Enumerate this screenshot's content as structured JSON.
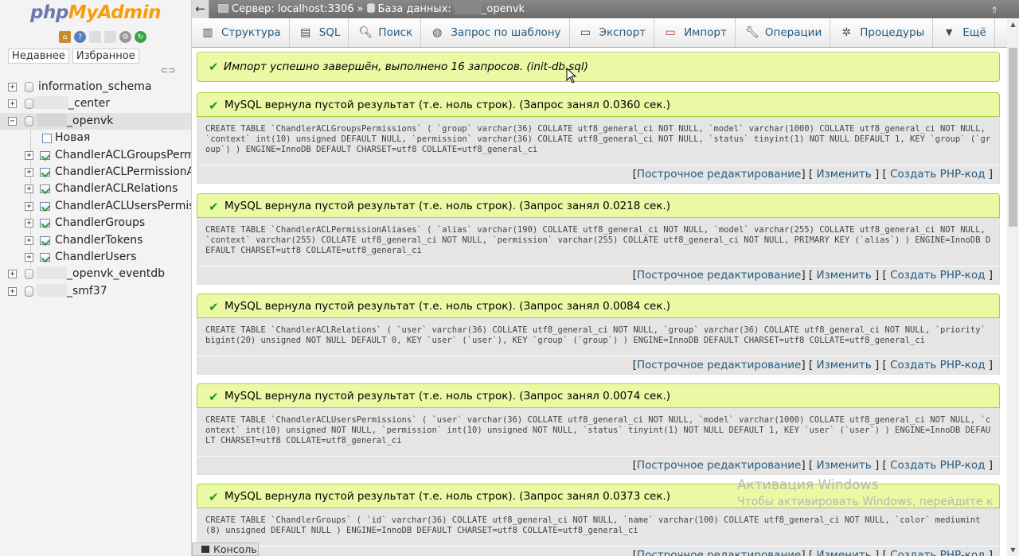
{
  "logo": {
    "part1": "php",
    "part2": "MyAdmin"
  },
  "nav": {
    "tabs": [
      "Недавнее",
      "Избранное"
    ],
    "tree": [
      {
        "label": "information_schema"
      },
      {
        "label": "_center",
        "redacted": true
      },
      {
        "label": "_openvk",
        "redacted": true,
        "selected": true
      },
      {
        "label": "Новая",
        "kind": "new"
      },
      {
        "label": "ChandlerACLGroupsPermissi",
        "kind": "table"
      },
      {
        "label": "ChandlerACLPermissionAlias",
        "kind": "table"
      },
      {
        "label": "ChandlerACLRelations",
        "kind": "table"
      },
      {
        "label": "ChandlerACLUsersPermissio",
        "kind": "table"
      },
      {
        "label": "ChandlerGroups",
        "kind": "table"
      },
      {
        "label": "ChandlerTokens",
        "kind": "table"
      },
      {
        "label": "ChandlerUsers",
        "kind": "table"
      },
      {
        "label": "_openvk_eventdb",
        "redacted": true
      },
      {
        "label": "_smf37",
        "redacted": true
      }
    ]
  },
  "topbar": {
    "server_label": "Сервер: localhost:3306",
    "separator": "»",
    "db_label": "База данных:",
    "db_name": "_openvk"
  },
  "tabs": [
    {
      "label": "Структура",
      "icon": "structure-icon"
    },
    {
      "label": "SQL",
      "icon": "sql-icon"
    },
    {
      "label": "Поиск",
      "icon": "search-icon"
    },
    {
      "label": "Запрос по шаблону",
      "icon": "query-icon"
    },
    {
      "label": "Экспорт",
      "icon": "export-icon"
    },
    {
      "label": "Импорт",
      "icon": "import-icon"
    },
    {
      "label": "Операции",
      "icon": "wrench-icon"
    },
    {
      "label": "Процедуры",
      "icon": "routines-icon"
    },
    {
      "label": "Ещё",
      "icon": "chevron-down-icon"
    }
  ],
  "import_notice": "Импорт успешно завершён, выполнено 16 запросов. (init-db.sql)",
  "results": [
    {
      "message": "MySQL вернула пустой результат (т.е. ноль строк). (Запрос занял 0.0360 сек.)",
      "sql": "CREATE TABLE `ChandlerACLGroupsPermissions` ( `group` varchar(36) COLLATE utf8_general_ci NOT NULL, `model` varchar(1000) COLLATE utf8_general_ci NOT NULL, `context` int(10) unsigned DEFAULT NULL, `permission` varchar(36) COLLATE utf8_general_ci NOT NULL, `status` tinyint(1) NOT NULL DEFAULT 1, KEY `group` (`group`) ) ENGINE=InnoDB DEFAULT CHARSET=utf8 COLLATE=utf8_general_ci"
    },
    {
      "message": "MySQL вернула пустой результат (т.е. ноль строк). (Запрос занял 0.0218 сек.)",
      "sql": "CREATE TABLE `ChandlerACLPermissionAliases` ( `alias` varchar(190) COLLATE utf8_general_ci NOT NULL, `model` varchar(255) COLLATE utf8_general_ci NOT NULL, `context` varchar(255) COLLATE utf8_general_ci NOT NULL, `permission` varchar(255) COLLATE utf8_general_ci NOT NULL, PRIMARY KEY (`alias`) ) ENGINE=InnoDB DEFAULT CHARSET=utf8 COLLATE=utf8_general_ci"
    },
    {
      "message": "MySQL вернула пустой результат (т.е. ноль строк). (Запрос занял 0.0084 сек.)",
      "sql": "CREATE TABLE `ChandlerACLRelations` ( `user` varchar(36) COLLATE utf8_general_ci NOT NULL, `group` varchar(36) COLLATE utf8_general_ci NOT NULL, `priority` bigint(20) unsigned NOT NULL DEFAULT 0, KEY `user` (`user`), KEY `group` (`group`) ) ENGINE=InnoDB DEFAULT CHARSET=utf8 COLLATE=utf8_general_ci"
    },
    {
      "message": "MySQL вернула пустой результат (т.е. ноль строк). (Запрос занял 0.0074 сек.)",
      "sql": "CREATE TABLE `ChandlerACLUsersPermissions` ( `user` varchar(36) COLLATE utf8_general_ci NOT NULL, `model` varchar(1000) COLLATE utf8_general_ci NOT NULL, `context` int(10) unsigned NOT NULL, `permission` int(10) unsigned NOT NULL, `status` tinyint(1) NOT NULL DEFAULT 1, KEY `user` (`user`) ) ENGINE=InnoDB DEFAULT CHARSET=utf8 COLLATE=utf8_general_ci"
    },
    {
      "message": "MySQL вернула пустой результат (т.е. ноль строк). (Запрос занял 0.0373 сек.)",
      "sql": "CREATE TABLE `ChandlerGroups` ( `id` varchar(36) COLLATE utf8_general_ci NOT NULL, `name` varchar(100) COLLATE utf8_general_ci NOT NULL, `color` mediumint(8) unsigned DEFAULT NULL ) ENGINE=InnoDB DEFAULT CHARSET=utf8 COLLATE=utf8_general_ci"
    }
  ],
  "result_links": {
    "inline_edit": "Построчное редактирование",
    "edit": "Изменить",
    "create_php": "Создать PHP-код"
  },
  "console_label": "Консоль",
  "watermark": {
    "title": "Активация Windows",
    "subtitle": "Чтобы активировать Windows, перейдите к"
  }
}
